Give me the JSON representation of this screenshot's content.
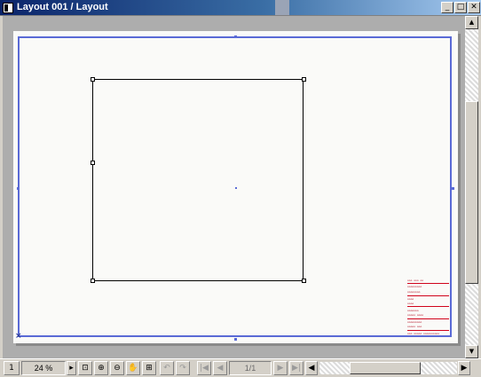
{
  "window": {
    "title": "Layout 001 / Layout",
    "minimize_glyph": "_",
    "maximize_glyph": "□",
    "close_glyph": "✕"
  },
  "layout_sheet": {
    "corner_mark": "×",
    "title_block": {
      "color": "#d0021b",
      "rows": [
        "ooo   ooo oo",
        "ooooooooo",
        "oooooooo",
        "oooo",
        "oooo",
        "ooooooo",
        "ooooo oooo",
        "ooooooooo",
        "ooooo ooo",
        "ooo   ooooo  oooooooooo"
      ]
    }
  },
  "scrollbars": {
    "up_glyph": "▲",
    "down_glyph": "▼",
    "right_glyph": "▶"
  },
  "statusbar": {
    "layout_icon_label": "1",
    "zoom": "24 %",
    "zoom_arrow": "▸",
    "zoom_fit_glyph": "⊡",
    "zoom_in_glyph": "⊕",
    "zoom_out_glyph": "⊖",
    "pan_glyph": "✋",
    "fit_glyph": "⊞",
    "undo_glyph": "↶",
    "redo_glyph": "↷",
    "first_glyph": "|◀",
    "prev_glyph": "◀",
    "page": "1/1",
    "next_glyph": "▶",
    "last_glyph": "▶|",
    "hscroll_left_glyph": "◀"
  }
}
